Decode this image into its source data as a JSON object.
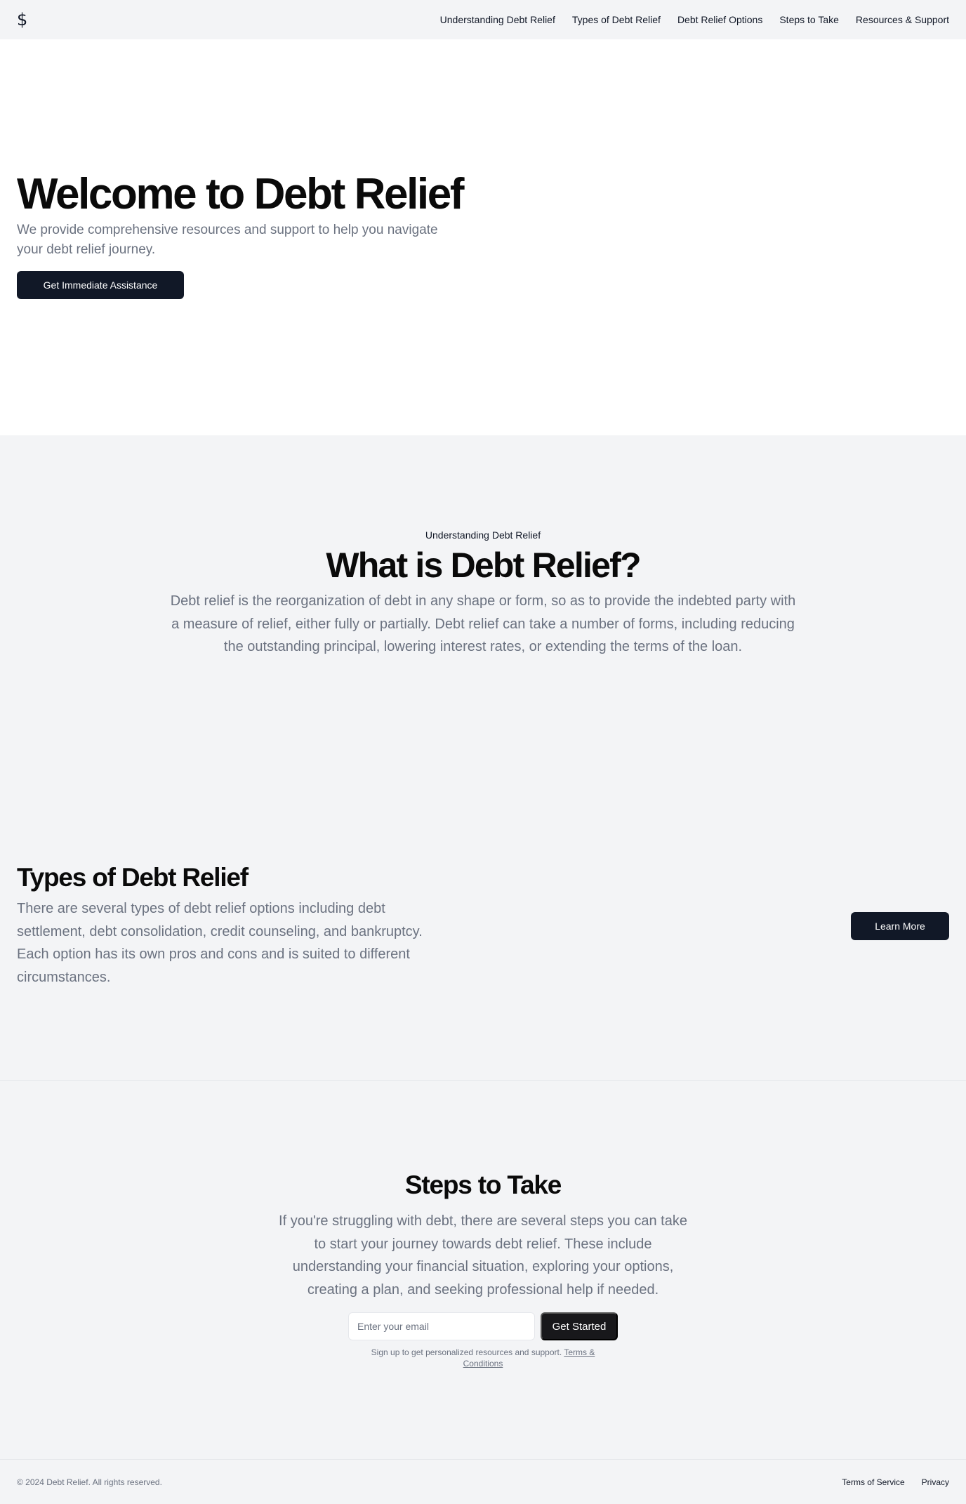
{
  "header": {
    "logo_icon": "dollar-sign-icon",
    "logo_glyph": "$",
    "nav": [
      "Understanding Debt Relief",
      "Types of Debt Relief",
      "Debt Relief Options",
      "Steps to Take",
      "Resources & Support"
    ]
  },
  "hero": {
    "title": "Welcome to Debt Relief",
    "subtitle": "We provide comprehensive resources and support to help you navigate your debt relief journey.",
    "cta": "Get Immediate Assistance"
  },
  "understanding": {
    "eyebrow": "Understanding Debt Relief",
    "title": "What is Debt Relief?",
    "body": "Debt relief is the reorganization of debt in any shape or form, so as to provide the indebted party with a measure of relief, either fully or partially. Debt relief can take a number of forms, including reducing the outstanding principal, lowering interest rates, or extending the terms of the loan."
  },
  "types": {
    "title": "Types of Debt Relief",
    "body": "There are several types of debt relief options including debt settlement, debt consolidation, credit counseling, and bankruptcy. Each option has its own pros and cons and is suited to different circumstances.",
    "cta": "Learn More"
  },
  "steps": {
    "title": "Steps to Take",
    "body": "If you're struggling with debt, there are several steps you can take to start your journey towards debt relief. These include understanding your financial situation, exploring your options, creating a plan, and seeking professional help if needed.",
    "email_placeholder": "Enter your email",
    "cta": "Get Started",
    "note": "Sign up to get personalized resources and support.",
    "terms_link": "Terms & Conditions"
  },
  "footer": {
    "copyright": "© 2024 Debt Relief. All rights reserved.",
    "links": [
      "Terms of Service",
      "Privacy"
    ]
  },
  "colors": {
    "primary": "#111827",
    "muted_text": "#6b7280",
    "page_bg": "#f3f4f6",
    "hero_bg": "#ffffff"
  }
}
